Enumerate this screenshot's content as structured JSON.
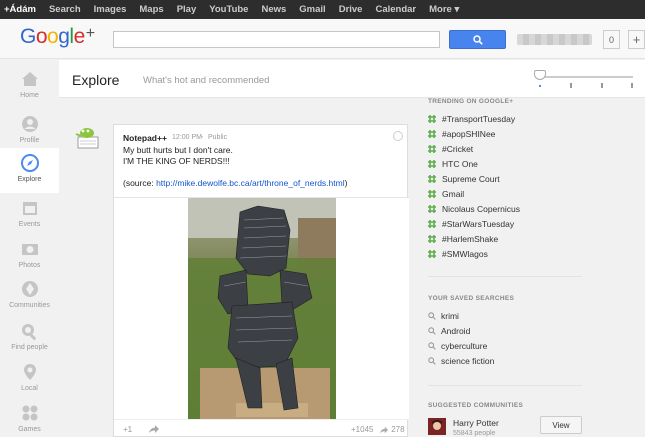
{
  "topbar": {
    "items": [
      {
        "label": "+Ádám",
        "active": true
      },
      {
        "label": "Search"
      },
      {
        "label": "Images"
      },
      {
        "label": "Maps"
      },
      {
        "label": "Play"
      },
      {
        "label": "YouTube"
      },
      {
        "label": "News"
      },
      {
        "label": "Gmail"
      },
      {
        "label": "Drive"
      },
      {
        "label": "Calendar"
      },
      {
        "label": "More ▾"
      }
    ]
  },
  "header": {
    "logo_plus": "+",
    "notification_count": "0",
    "share_label": "+"
  },
  "leftnav": {
    "items": [
      {
        "label": "Home",
        "icon": "home-icon"
      },
      {
        "label": "Profile",
        "icon": "profile-icon"
      },
      {
        "label": "Explore",
        "icon": "compass-icon",
        "active": true
      },
      {
        "label": "Events",
        "icon": "calendar-icon"
      },
      {
        "label": "Photos",
        "icon": "camera-icon"
      },
      {
        "label": "Communities",
        "icon": "communities-icon"
      },
      {
        "label": "Find people",
        "icon": "find-people-icon"
      },
      {
        "label": "Local",
        "icon": "pin-icon"
      },
      {
        "label": "Games",
        "icon": "games-icon"
      }
    ]
  },
  "explore": {
    "title": "Explore",
    "subtitle": "What's hot and recommended"
  },
  "post": {
    "author": "Notepad++",
    "time": "12:00 PM",
    "separator": "-",
    "scope": "Public",
    "line1": "My butt hurts but I don't care.",
    "line2": "I'M THE KING OF NERDS!!!",
    "source_prefix": "(source: ",
    "source_link": "http://mike.dewolfe.bc.ca/art/throne_of_nerds.html",
    "source_suffix": ")",
    "plus_one": "+1",
    "plus_count": "+1045",
    "share_count": "278"
  },
  "trending": {
    "title": "TRENDING ON GOOGLE+",
    "items": [
      "#TransportTuesday",
      "#apopSHINee",
      "#Cricket",
      "HTC One",
      "Supreme Court",
      "Gmail",
      "Nicolaus Copernicus",
      "#StarWarsTuesday",
      "#HarlemShake",
      "#SMWlagos"
    ]
  },
  "saved": {
    "title": "YOUR SAVED SEARCHES",
    "items": [
      "krimi",
      "Android",
      "cyberculture",
      "science fiction"
    ]
  },
  "communities": {
    "title": "SUGGESTED COMMUNITIES",
    "name": "Harry Potter",
    "count": "55843 people",
    "view_label": "View"
  },
  "colors": {
    "accent_blue": "#4784ee",
    "link": "#15c",
    "trend_green": "#5fae4e"
  }
}
